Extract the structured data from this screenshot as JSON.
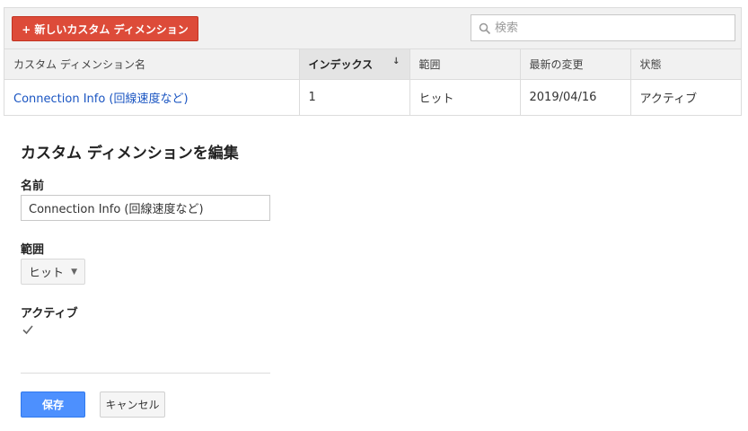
{
  "toolbar": {
    "new_button_label": "+ 新しいカスタム ディメンション",
    "search_placeholder": "検索"
  },
  "table": {
    "columns": [
      {
        "label": "カスタム ディメンション名"
      },
      {
        "label": "インデックス",
        "sorted": true,
        "sort_icon": "↓"
      },
      {
        "label": "範囲"
      },
      {
        "label": "最新の変更"
      },
      {
        "label": "状態"
      }
    ],
    "rows": [
      {
        "name": "Connection Info (回線速度など)",
        "index": "1",
        "scope": "ヒット",
        "modified": "2019/04/16",
        "status": "アクティブ"
      }
    ]
  },
  "edit": {
    "title": "カスタム ディメンションを編集",
    "name_label": "名前",
    "name_value": "Connection Info (回線速度など)",
    "scope_label": "範囲",
    "scope_value": "ヒット",
    "active_label": "アクティブ",
    "active_checked": true,
    "save_label": "保存",
    "cancel_label": "キャンセル"
  },
  "colors": {
    "new_button": "#dd4b39",
    "save_button": "#4d90fe",
    "link": "#1a55c2"
  }
}
